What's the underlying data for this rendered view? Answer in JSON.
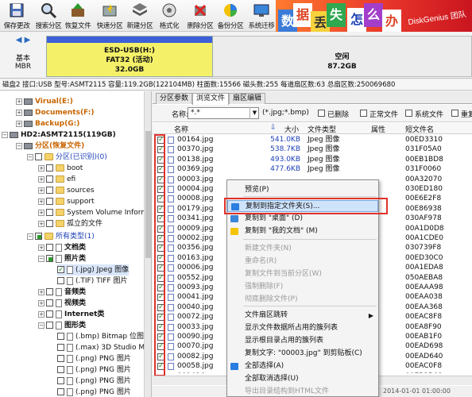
{
  "toolbar": {
    "buttons": [
      {
        "label": "保存更改",
        "icon": "save-icon"
      },
      {
        "label": "搜索分区",
        "icon": "search-icon"
      },
      {
        "label": "恢复文件",
        "icon": "recover-icon"
      },
      {
        "label": "快速分区",
        "icon": "quick-partition-icon"
      },
      {
        "label": "新建分区",
        "icon": "new-partition-icon"
      },
      {
        "label": "格式化",
        "icon": "format-icon"
      },
      {
        "label": "删除分区",
        "icon": "delete-icon"
      },
      {
        "label": "备份分区",
        "icon": "backup-icon"
      },
      {
        "label": "系统迁移",
        "icon": "migrate-icon"
      }
    ],
    "banner_tiles": [
      "数",
      "据",
      "丢",
      "失",
      "怎",
      "么",
      "办"
    ],
    "brand": "DiskGenius 团队"
  },
  "disk": {
    "basic": "基本",
    "type": "MBR",
    "main_partition": {
      "name": "ESD-USB(H:)",
      "fs": "FAT32 (活动)",
      "size": "32.0GB"
    },
    "free": {
      "label": "空闲",
      "size": "87.2GB"
    },
    "info": "磁盘2 接口:USB 型号:ASMT2115 容量:119.2GB(122104MB) 柱面数:15566 磁头数:255 每道扇区数:63 总扇区数:250069680"
  },
  "tree": {
    "items": [
      {
        "label": "Virual(E:)"
      },
      {
        "label": "Documents(F:)"
      },
      {
        "label": "Backup(G:)"
      },
      {
        "label": "HD2:ASMT2115(119GB)"
      },
      {
        "label": "分区(恢复文件)"
      },
      {
        "label": "分区(已识别)(0)"
      },
      {
        "label": "boot"
      },
      {
        "label": "efi"
      },
      {
        "label": "sources"
      },
      {
        "label": "support"
      },
      {
        "label": "System Volume Inform"
      },
      {
        "label": "孤立的文件"
      },
      {
        "label": "所有类型(1)"
      },
      {
        "label": "文档类"
      },
      {
        "label": "照片类"
      },
      {
        "label": "(.jpg) Jpeg 图像"
      },
      {
        "label": "(.TIF) TIFF 图片"
      },
      {
        "label": "音频类"
      },
      {
        "label": "视频类"
      },
      {
        "label": "Internet类"
      },
      {
        "label": "图形类"
      },
      {
        "label": "(.bmp) Bitmap 位图"
      },
      {
        "label": "(.max) 3D Studio M"
      },
      {
        "label": "(.png) PNG 图片"
      },
      {
        "label": "(.png) PNG 图片"
      },
      {
        "label": "(.png) PNG 图片"
      },
      {
        "label": "(.png) PNG 图片"
      }
    ]
  },
  "tabs": [
    "分区参数",
    "浏览文件",
    "扇区编辑"
  ],
  "filter": {
    "name_label": "名称:",
    "name_value": "*.*",
    "type_hint": "(*.jpg;*.bmp)",
    "deleted": "已删除",
    "normal": "正常文件",
    "system": "系统文件",
    "dup": "重复"
  },
  "columns": {
    "name": "名称",
    "size": "大小",
    "type": "文件类型",
    "attr": "属性",
    "short": "短文件名"
  },
  "files": [
    {
      "name": "00164.jpg",
      "size": "541.0KB",
      "type": "Jpeg 图像",
      "short": "00ED3310"
    },
    {
      "name": "00370.jpg",
      "size": "538.7KB",
      "type": "Jpeg 图像",
      "short": "031F05A0"
    },
    {
      "name": "00138.jpg",
      "size": "493.0KB",
      "type": "Jpeg 图像",
      "short": "00EB1BD8"
    },
    {
      "name": "00369.jpg",
      "size": "477.6KB",
      "type": "Jpeg 图像",
      "short": "031F0060"
    },
    {
      "name": "00003.jpg",
      "size": "",
      "type": "",
      "short": "00A32070"
    },
    {
      "name": "00004.jpg",
      "size": "",
      "type": "",
      "short": "030ED180"
    },
    {
      "name": "00008.jpg",
      "size": "",
      "type": "",
      "short": "00E6E2F8"
    },
    {
      "name": "00179.jpg",
      "size": "",
      "type": "",
      "short": "00E86938"
    },
    {
      "name": "00341.jpg",
      "size": "",
      "type": "",
      "short": "030AF978"
    },
    {
      "name": "00009.jpg",
      "size": "",
      "type": "",
      "short": "00A1D0D8"
    },
    {
      "name": "00002.jpg",
      "size": "",
      "type": "",
      "short": "00A1CDE0"
    },
    {
      "name": "00356.jpg",
      "size": "",
      "type": "",
      "short": "030739F8"
    },
    {
      "name": "00163.jpg",
      "size": "",
      "type": "",
      "short": "00ED30C0"
    },
    {
      "name": "00006.jpg",
      "size": "",
      "type": "",
      "short": "00A1EDA8"
    },
    {
      "name": "00552.jpg",
      "size": "",
      "type": "",
      "short": "050AEBA8"
    },
    {
      "name": "00093.jpg",
      "size": "",
      "type": "",
      "short": "00EAAA98"
    },
    {
      "name": "00041.jpg",
      "size": "",
      "type": "",
      "short": "00EAA038"
    },
    {
      "name": "00040.jpg",
      "size": "",
      "type": "",
      "short": "00EAA368"
    },
    {
      "name": "00072.jpg",
      "size": "",
      "type": "",
      "short": "00EAC8F8"
    },
    {
      "name": "00033.jpg",
      "size": "",
      "type": "",
      "short": "00EA8F90"
    },
    {
      "name": "00090.jpg",
      "size": "",
      "type": "",
      "short": "00EAB1F0"
    },
    {
      "name": "00070.jpg",
      "size": "",
      "type": "",
      "short": "00EAD698"
    },
    {
      "name": "00082.jpg",
      "size": "",
      "type": "",
      "short": "00EAD640"
    },
    {
      "name": "00058.jpg",
      "size": "",
      "type": "",
      "short": "00EAC0F8"
    },
    {
      "name": "00148.jpg",
      "size": "",
      "type": "",
      "short": "00EB2B68"
    }
  ],
  "context_menu": [
    {
      "label": "预览(P)",
      "state": "enabled"
    },
    {
      "label": "复制到指定文件夹(S)...",
      "state": "highlight",
      "icon": "copy-folder-icon"
    },
    {
      "label": "复制到 \"桌面\" (D)",
      "state": "enabled",
      "icon": "desktop-icon"
    },
    {
      "label": "复制到 \"我的文档\" (M)",
      "state": "enabled",
      "icon": "documents-icon"
    },
    {
      "label": "新建文件夹(N)",
      "state": "disabled"
    },
    {
      "label": "重命名(R)",
      "state": "disabled"
    },
    {
      "label": "复制文件到当前分区(W)",
      "state": "disabled"
    },
    {
      "label": "强制删除(F)",
      "state": "disabled"
    },
    {
      "label": "彻底删除文件(P)",
      "state": "disabled"
    },
    {
      "label": "文件扇区跳转",
      "state": "enabled",
      "submenu": true
    },
    {
      "label": "显示文件数据所占用的簇列表",
      "state": "enabled"
    },
    {
      "label": "显示根目录占用的簇列表",
      "state": "enabled"
    },
    {
      "label": "复制文字: \"00003.jpg\" 到剪贴板(C)",
      "state": "enabled"
    },
    {
      "label": "全部选择(A)",
      "state": "enabled",
      "icon": "check-all-icon"
    },
    {
      "label": "全部取消选择(U)",
      "state": "enabled"
    },
    {
      "label": "导出目录结构到HTML文件",
      "state": "disabled"
    }
  ],
  "status_partial": "2014-01-01 01:00:00"
}
